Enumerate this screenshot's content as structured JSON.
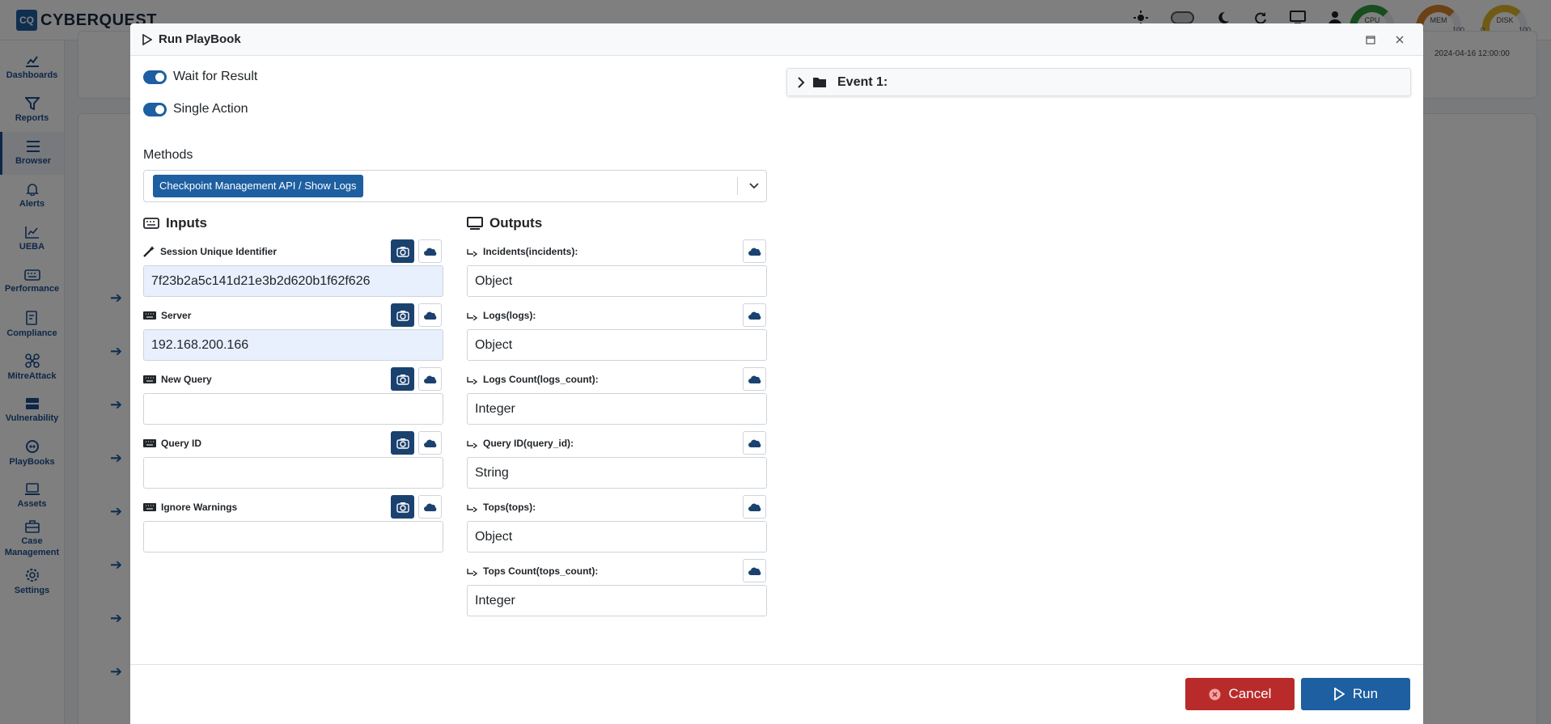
{
  "app": {
    "logo_mark": "CQ",
    "logo_text": "CYBERQUEST",
    "gauges": [
      {
        "label": "CPU",
        "min": "",
        "max": ""
      },
      {
        "label": "MEM",
        "min": "",
        "max": "100"
      },
      {
        "label": "DISK",
        "min": "0",
        "max": "100"
      }
    ],
    "sidebar": [
      {
        "label": "Dashboards",
        "icon": "dashboard-icon"
      },
      {
        "label": "Reports",
        "icon": "filter-icon"
      },
      {
        "label": "Browser",
        "icon": "list-icon"
      },
      {
        "label": "Alerts",
        "icon": "bell-icon"
      },
      {
        "label": "UEBA",
        "icon": "chart-line-icon"
      },
      {
        "label": "Performance",
        "icon": "keyboard-icon"
      },
      {
        "label": "Compliance",
        "icon": "compliance-icon"
      },
      {
        "label": "MitreAttack",
        "icon": "network-icon"
      },
      {
        "label": "Vulnerability",
        "icon": "server-icon"
      },
      {
        "label": "PlayBooks",
        "icon": "playbook-icon"
      },
      {
        "label": "Assets",
        "icon": "laptop-icon"
      },
      {
        "label": "Case\nManagement",
        "icon": "briefcase-icon"
      },
      {
        "label": "Settings",
        "icon": "gear-icon"
      }
    ],
    "bg_date": "2024-04-16 12:00:00"
  },
  "modal": {
    "title": "Run PlayBook",
    "wait_for_result_label": "Wait for Result",
    "single_action_label": "Single Action",
    "methods_label": "Methods",
    "methods_selected": "Checkpoint Management API / Show Logs",
    "inputs_title": "Inputs",
    "outputs_title": "Outputs",
    "inputs": [
      {
        "label": "Session Unique Identifier",
        "value": "7f23b2a5c141d21e3b2d620b1f62f626",
        "icon": "magic-icon"
      },
      {
        "label": "Server",
        "value": "192.168.200.166",
        "icon": "keyboard-icon"
      },
      {
        "label": "New Query",
        "value": "",
        "icon": "keyboard-icon"
      },
      {
        "label": "Query ID",
        "value": "",
        "icon": "keyboard-icon"
      },
      {
        "label": "Ignore Warnings",
        "value": "",
        "icon": "keyboard-icon"
      }
    ],
    "outputs": [
      {
        "label": "Incidents(incidents):",
        "value": "Object"
      },
      {
        "label": "Logs(logs):",
        "value": "Object"
      },
      {
        "label": "Logs Count(logs_count):",
        "value": "Integer"
      },
      {
        "label": "Query ID(query_id):",
        "value": "String"
      },
      {
        "label": "Tops(tops):",
        "value": "Object"
      },
      {
        "label": "Tops Count(tops_count):",
        "value": "Integer"
      }
    ],
    "event_title": "Event 1:",
    "cancel_label": "Cancel",
    "run_label": "Run"
  }
}
